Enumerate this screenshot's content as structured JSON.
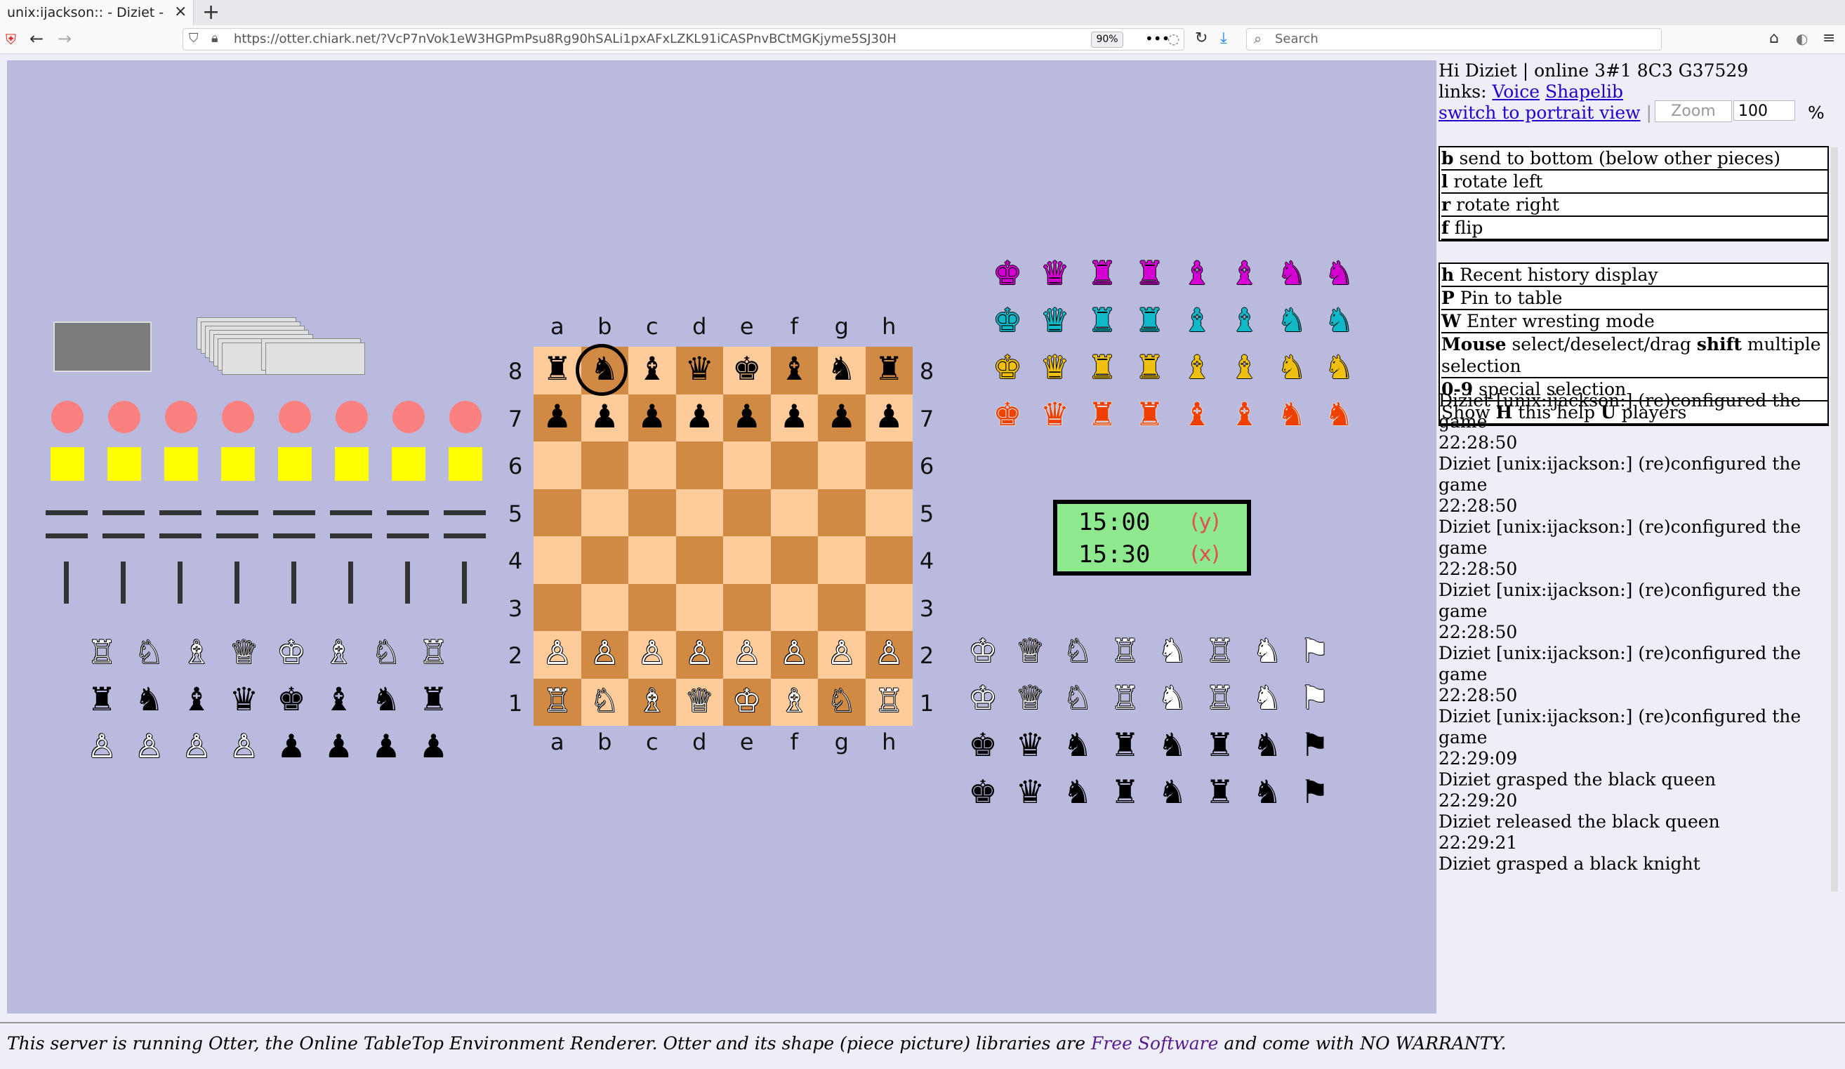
{
  "browser": {
    "tab_title": "unix:ijackson:: - Diziet - Otter",
    "url": "https://otter.chiark.net/?VcP7nVok1eW3HGPmPsu8Rg90hSALi1pxAFxLZKL91iCASPnvBCtMGKjyme5SJ30H",
    "zoom_badge": "90%",
    "search_placeholder": "Search"
  },
  "board": {
    "files": [
      "a",
      "b",
      "c",
      "d",
      "e",
      "f",
      "g",
      "h"
    ],
    "ranks": [
      "8",
      "7",
      "6",
      "5",
      "4",
      "3",
      "2",
      "1"
    ],
    "position": [
      [
        "♜",
        "♞",
        "♝",
        "♛",
        "♚",
        "♝",
        "♞",
        "♜"
      ],
      [
        "♟",
        "♟",
        "♟",
        "♟",
        "♟",
        "♟",
        "♟",
        "♟"
      ],
      [
        "",
        "",
        "",
        "",
        "",
        "",
        "",
        ""
      ],
      [
        "",
        "",
        "",
        "",
        "",
        "",
        "",
        ""
      ],
      [
        "",
        "",
        "",
        "",
        "",
        "",
        "",
        ""
      ],
      [
        "",
        "",
        "",
        "",
        "",
        "",
        "",
        ""
      ],
      [
        "♙",
        "♙",
        "♙",
        "♙",
        "♙",
        "♙",
        "♙",
        "♙"
      ],
      [
        "♖",
        "♘",
        "♗",
        "♕",
        "♔",
        "♗",
        "♘",
        "♖"
      ]
    ]
  },
  "spare_pieces": {
    "row1": [
      "♖",
      "♘",
      "♗",
      "♕",
      "♔",
      "♗",
      "♘",
      "♖"
    ],
    "row2": [
      "♜",
      "♞",
      "♝",
      "♛",
      "♚",
      "♝",
      "♞",
      "♜"
    ],
    "row3": [
      "♙",
      "♙",
      "♙",
      "♙",
      "♟",
      "♟",
      "♟",
      "♟"
    ]
  },
  "colored_sets": {
    "glyphs": [
      "♚",
      "♛",
      "♜",
      "♜",
      "♝",
      "♝",
      "♞",
      "♞"
    ],
    "colors": {
      "magenta": "#d400d4",
      "cyan": "#10b8c8",
      "yellow": "#f0c010",
      "orange": "#f04000"
    }
  },
  "xiangqi_like": {
    "white_row": [
      "♔",
      "♕",
      "♘",
      "♖",
      "♞",
      "♖",
      "♞",
      "⚑"
    ],
    "black_row": [
      "♚",
      "♛",
      "♞",
      "♜",
      "♞",
      "♜",
      "♞",
      "⚑"
    ]
  },
  "chess_clock": {
    "rows": [
      {
        "time": "15:00",
        "label": "(y)"
      },
      {
        "time": "15:30",
        "label": "(x)"
      }
    ]
  },
  "sidebar": {
    "greeting": "Hi Diziet | online 3#1 8C3 G37529",
    "links_label": "links:",
    "link_voice": "Voice",
    "link_shapelib": "Shapelib",
    "portrait_link": "switch to portrait view",
    "separator": "|",
    "zoom_placeholder": "Zoom",
    "zoom_value": "100",
    "percent": "%",
    "help_block1": [
      {
        "key": "b",
        "text": "send to bottom (below other pieces)"
      },
      {
        "key": "l",
        "text": "rotate left"
      },
      {
        "key": "r",
        "text": "rotate right"
      },
      {
        "key": "f",
        "text": "flip"
      }
    ],
    "help_block2": [
      {
        "key": "h",
        "text": "Recent history display"
      },
      {
        "key": "P",
        "text": "Pin to table"
      },
      {
        "key": "W",
        "text": "Enter wresting mode"
      },
      {
        "key": "Mouse",
        "text": "select/deselect/drag",
        "key2": "shift",
        "text2": "multiple selection"
      },
      {
        "key": "0-9",
        "text": "special selection"
      },
      {
        "pre": "Show",
        "key": "H",
        "text": "this help",
        "key2": "U",
        "text2": "players"
      }
    ],
    "log": [
      "Diziet [unix:ijackson:] (re)configured the game",
      "22:28:50",
      "Diziet [unix:ijackson:] (re)configured the game",
      "22:28:50",
      "Diziet [unix:ijackson:] (re)configured the game",
      "22:28:50",
      "Diziet [unix:ijackson:] (re)configured the game",
      "22:28:50",
      "Diziet [unix:ijackson:] (re)configured the game",
      "22:28:50",
      "Diziet [unix:ijackson:] (re)configured the game",
      "22:29:09",
      "Diziet grasped the black queen",
      "22:29:20",
      "Diziet released the black queen",
      "22:29:21",
      "Diziet grasped a black knight"
    ]
  },
  "footer": {
    "pre": "This server is running Otter, the Online TableTop Environment Renderer. Otter and its shape (piece picture) libraries are ",
    "link": "Free Software",
    "post": " and come with NO WARRANTY."
  }
}
